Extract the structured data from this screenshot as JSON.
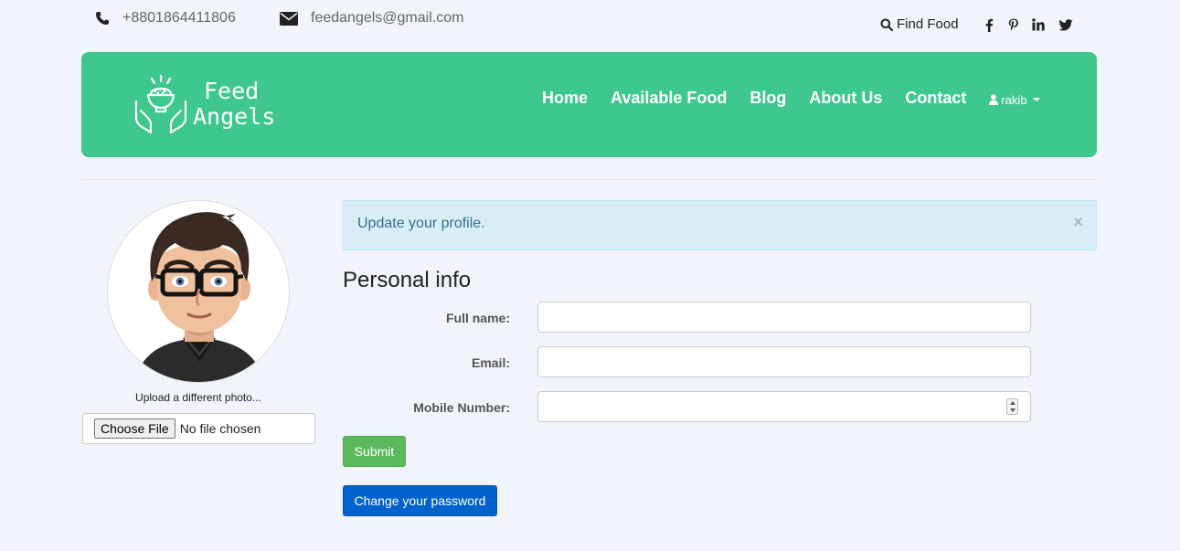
{
  "topbar": {
    "phone": "+8801864411806",
    "email": "feedangels@gmail.com",
    "find_food": "Find Food",
    "social": [
      {
        "icon": "facebook-icon",
        "glyph": "f"
      },
      {
        "icon": "pinterest-icon",
        "glyph": "p"
      },
      {
        "icon": "linkedin-icon",
        "glyph": "in"
      },
      {
        "icon": "twitter-icon",
        "glyph": "t"
      }
    ]
  },
  "navbar": {
    "logo_line1": "Feed",
    "logo_line2": "Angels",
    "links": [
      "Home",
      "Available Food",
      "Blog",
      "About Us",
      "Contact"
    ],
    "user": "rakib",
    "color": "#3ec88e"
  },
  "profile": {
    "upload_label": "Upload a different photo...",
    "file_button": "Choose File",
    "file_status": "No file chosen"
  },
  "alert": {
    "message": "Update your profile.",
    "close": "×"
  },
  "form": {
    "title": "Personal info",
    "fields": [
      {
        "label": "Full name:",
        "value": ""
      },
      {
        "label": "Email:",
        "value": ""
      },
      {
        "label": "Mobile Number:",
        "value": ""
      }
    ],
    "submit": "Submit",
    "change_password": "Change your password"
  }
}
